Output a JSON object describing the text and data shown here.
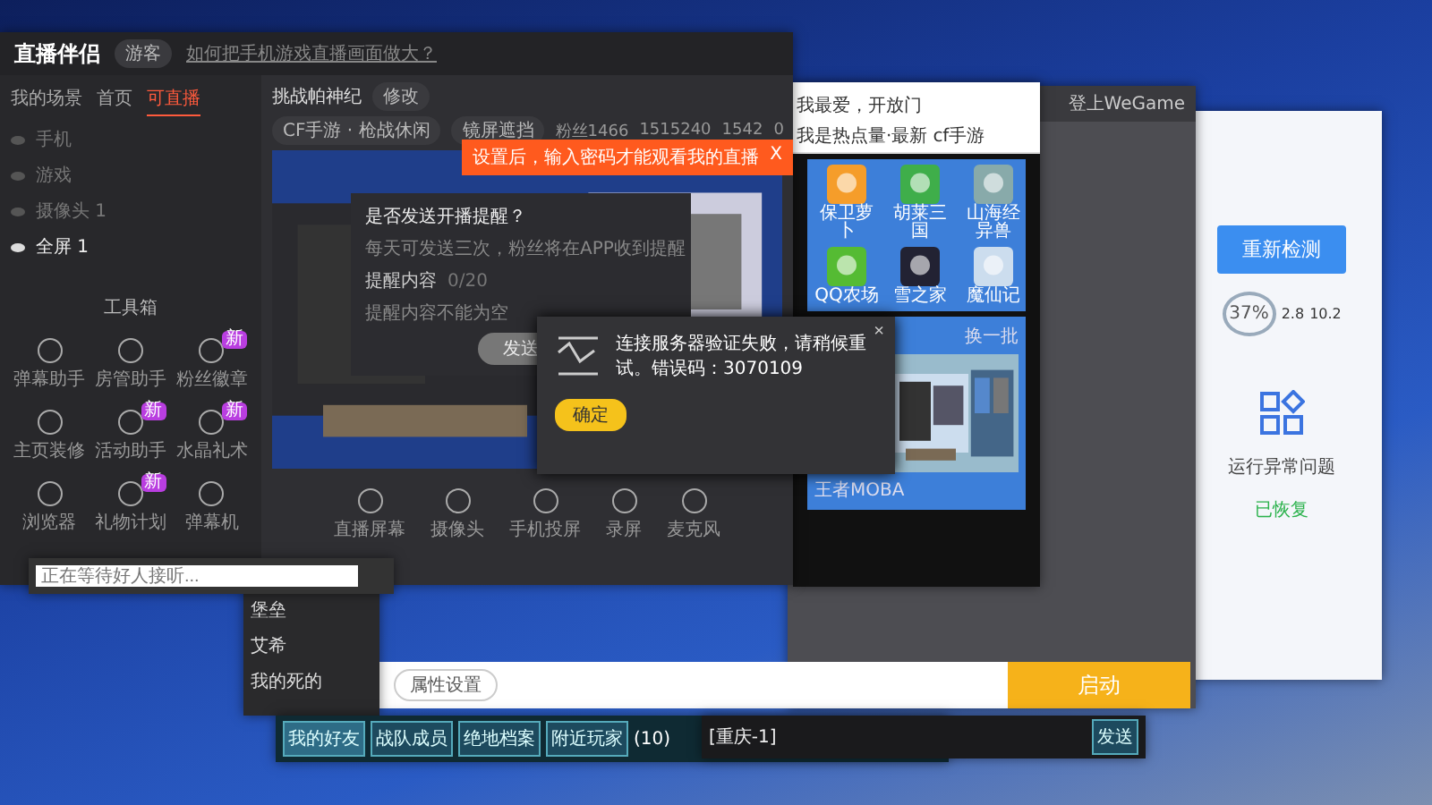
{
  "streamer": {
    "title": "直播伴侣",
    "badge": "游客",
    "help_link": "如何把手机游戏直播画面做大？",
    "side_tabs": [
      {
        "label": "我的场景",
        "selected": false
      },
      {
        "label": "首页",
        "selected": false
      },
      {
        "label": "可直播",
        "selected": true
      }
    ],
    "sources": [
      {
        "label": "手机",
        "visible": false
      },
      {
        "label": "游戏",
        "visible": false
      },
      {
        "label": "摄像头 1",
        "visible": false
      },
      {
        "label": "全屏 1",
        "visible": true
      }
    ],
    "tools_title": "工具箱",
    "tools": [
      {
        "label": "弹幕助手"
      },
      {
        "label": "房管助手"
      },
      {
        "label": "粉丝徽章",
        "badge": "新"
      },
      {
        "label": "主页装修"
      },
      {
        "label": "活动助手",
        "badge": "新"
      },
      {
        "label": "水晶礼术",
        "badge": "新"
      },
      {
        "label": "浏览器"
      },
      {
        "label": "礼物计划",
        "badge": "新"
      },
      {
        "label": "弹幕机"
      }
    ],
    "room_title": "挑战帕神纪",
    "edit": "修改",
    "category": "CF手游 · 枪战休闲",
    "mirror": "镜屏遮挡",
    "stats": [
      "粉丝1466",
      "1515240",
      "1542",
      "0"
    ],
    "tip": "设置后，输入密码才能观看我的直播",
    "tip_close": "X",
    "reminder": {
      "title": "是否发送开播提醒？",
      "desc": "每天可发送三次，粉丝将在APP收到提醒",
      "label": "提醒内容",
      "count": "0/20",
      "hint": "提醒内容不能为空",
      "button": "发送"
    },
    "toolbar": [
      "直播屏幕",
      "摄像头",
      "手机投屏",
      "录屏",
      "麦克风"
    ]
  },
  "error_dialog": {
    "message": "连接服务器验证失败，请稍候重试。错误码：3070109",
    "close": "×",
    "button": "确定"
  },
  "browser": {
    "bookmarks": [
      "我最爱，开放门",
      "我是热点量·最新",
      "cf手游"
    ],
    "games": [
      {
        "label": "保卫萝卜"
      },
      {
        "label": "胡莱三国"
      },
      {
        "label": "山海经异兽"
      },
      {
        "label": "QQ农场"
      },
      {
        "label": "雪之家"
      },
      {
        "label": "魔仙记"
      }
    ],
    "more": "换一批",
    "banner_caption": "王者MOBA"
  },
  "launcher": {
    "title": "登上WeGame",
    "settings": "属性设置",
    "start": "启动"
  },
  "checker": {
    "recheck": "重新检测",
    "percent": "37%",
    "up": "2.8",
    "down": "10.2",
    "issue": "运行异常问题",
    "status": "已恢复"
  },
  "game": {
    "friends": [
      {
        "label": "堡垒"
      },
      {
        "label": "艾希"
      },
      {
        "label": "我的死的"
      }
    ],
    "tabs": [
      {
        "label": "我的好友",
        "selected": true
      },
      {
        "label": "战队成员",
        "selected": false
      },
      {
        "label": "绝地档案",
        "selected": false
      },
      {
        "label": "附近玩家",
        "selected": false
      }
    ],
    "mail": "(10)",
    "channel": "[重庆-1]",
    "send": "发送"
  },
  "chat": {
    "placeholder": "正在等待好人接听..."
  }
}
